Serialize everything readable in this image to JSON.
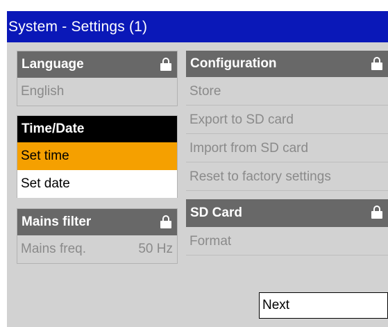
{
  "window": {
    "title": "System - Settings (1)"
  },
  "language": {
    "header": "Language",
    "value": "English"
  },
  "time_date": {
    "header": "Time/Date",
    "items": [
      "Set time",
      "Set date"
    ]
  },
  "mains_filter": {
    "header": "Mains filter",
    "label": "Mains freq.",
    "value": "50 Hz"
  },
  "configuration": {
    "header": "Configuration",
    "items": [
      "Store",
      "Export to SD card",
      "Import from SD card",
      "Reset to factory settings"
    ]
  },
  "sd_card": {
    "header": "SD Card",
    "items": [
      "Format"
    ]
  },
  "footer": {
    "next_label": "Next"
  },
  "colors": {
    "title_bar": "#0a18b8",
    "panel_header": "#686868",
    "selected": "#f5a000",
    "background": "#d2d2d2"
  },
  "icons": {
    "locked": "lock-icon"
  }
}
